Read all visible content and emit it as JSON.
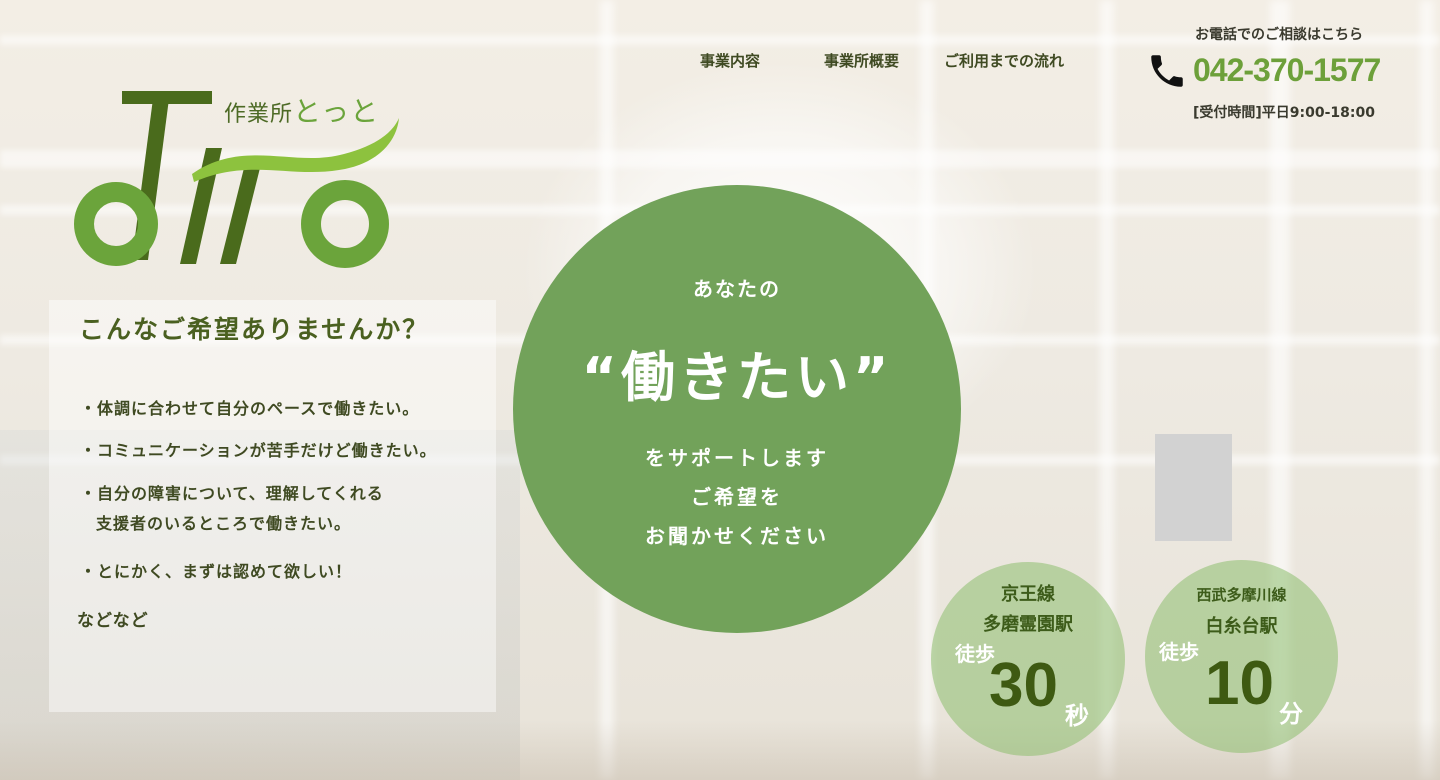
{
  "logo": {
    "brand_prefix": "作業所",
    "brand_name": "とっと"
  },
  "nav": {
    "items": [
      "事業内容",
      "事業所概要",
      "ご利用までの流れ"
    ]
  },
  "contact": {
    "label": "お電話でのご相談はこちら",
    "phone": "042-370-1577",
    "hours": "[受付時間]平日9:00-18:00"
  },
  "wishes": {
    "title": "こんなご希望ありませんか？",
    "items": [
      "・体調に合わせて自分のペースで働きたい。",
      "・コミュニケーションが苦手だけど働きたい。",
      "・自分の障害について、理解してくれる",
      "支援者のいるところで働きたい。",
      "・とにかく、まずは認めて欲しい！"
    ],
    "etc": "などなど"
  },
  "hero": {
    "line1": "あなたの",
    "line2": "“働きたい”",
    "line3": "をサポートします",
    "line4": "ご希望を",
    "line5": "お聞かせください"
  },
  "stations": [
    {
      "line": "京王線",
      "station": "多磨霊園駅",
      "walk": "徒歩",
      "time": "30",
      "unit": "秒"
    },
    {
      "line": "西武多摩川線",
      "station": "白糸台駅",
      "walk": "徒歩",
      "time": "10",
      "unit": "分"
    }
  ],
  "colors": {
    "brand_dark": "#4a6b1c",
    "brand_green": "#6da03a",
    "circle": "#72a25a"
  },
  "icons": {
    "phone": "phone-icon"
  }
}
